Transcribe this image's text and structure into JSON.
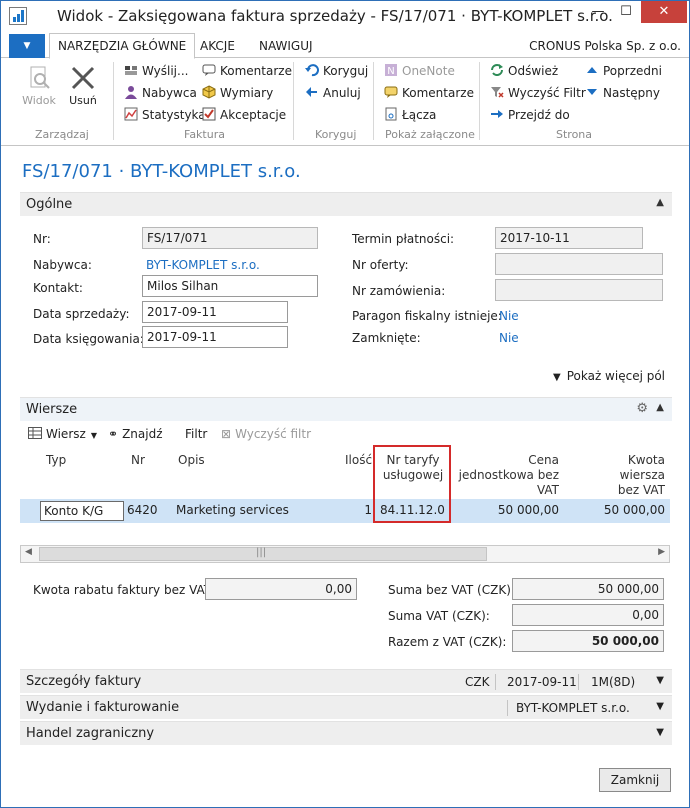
{
  "window": {
    "title": "Widok - Zaksięgowana faktura sprzedaży - FS/17/071 · BYT-KOMPLET s.r.o.",
    "min_glyph": "—",
    "max_glyph": "☐",
    "close_glyph": "✕"
  },
  "tabs": {
    "menu_glyph": "▼",
    "items": [
      "NARZĘDZIA GŁÓWNE",
      "AKCJE",
      "NAWIGUJ"
    ],
    "company": "CRONUS Polska Sp. z o.o."
  },
  "ribbon": {
    "zarzadzaj": {
      "label": "Zarządzaj",
      "widok": "Widok",
      "usun": "Usuń"
    },
    "faktura": {
      "label": "Faktura",
      "wyslij": "Wyślij...",
      "nabywca": "Nabywca",
      "statystyka": "Statystyka",
      "komentarze": "Komentarze",
      "wymiary": "Wymiary",
      "akceptacje": "Akceptacje"
    },
    "koryguj": {
      "label": "Koryguj",
      "koryguj": "Koryguj",
      "anuluj": "Anuluj"
    },
    "zalaczone": {
      "label": "Pokaż załączone",
      "onenote": "OneNote",
      "komentarze": "Komentarze",
      "lacza": "Łącza"
    },
    "strona": {
      "label": "Strona",
      "odswiez": "Odśwież",
      "wyczysc": "Wyczyść Filtr",
      "przejdz": "Przejdź do",
      "poprzedni": "Poprzedni",
      "nastepny": "Następny"
    }
  },
  "page": {
    "title": "FS/17/071 · BYT-KOMPLET s.r.o."
  },
  "ogolne": {
    "header": "Ogólne",
    "nr_label": "Nr:",
    "nr": "FS/17/071",
    "nabywca_label": "Nabywca:",
    "nabywca": "BYT-KOMPLET s.r.o.",
    "kontakt_label": "Kontakt:",
    "kontakt": "Milos Silhan",
    "data_sprzedazy_label": "Data sprzedaży:",
    "data_sprzedazy": "2017-09-11",
    "data_ksiegowania_label": "Data księgowania:",
    "data_ksiegowania": "2017-09-11",
    "termin_label": "Termin płatności:",
    "termin": "2017-10-11",
    "nr_oferty_label": "Nr oferty:",
    "nr_oferty": "",
    "nr_zamowienia_label": "Nr zamówienia:",
    "nr_zamowienia": "",
    "paragon_label": "Paragon fiskalny istnieje:",
    "paragon": "Nie",
    "zamkniete_label": "Zamknięte:",
    "zamkniete": "Nie",
    "more": "Pokaż więcej pól"
  },
  "wiersze": {
    "header": "Wiersze",
    "toolbar": {
      "wiersz": "Wiersz",
      "znajdz": "Znajdź",
      "filtr": "Filtr",
      "wyczysc": "Wyczyść filtr"
    },
    "columns": {
      "typ": "Typ",
      "nr": "Nr",
      "opis": "Opis",
      "ilosc": "Ilość",
      "taryfa1": "Nr taryfy",
      "taryfa2": "usługowej",
      "cena1": "Cena",
      "cena2": "jednostkowa bez",
      "cena3": "VAT",
      "kwota1": "Kwota wiersza",
      "kwota2": "bez VAT"
    },
    "row": {
      "typ": "Konto K/G",
      "nr": "6420",
      "opis": "Marketing services",
      "ilosc": "1",
      "taryfa": "84.11.12.0",
      "cena": "50 000,00",
      "kwota": "50 000,00"
    }
  },
  "totals": {
    "rabat_label": "Kwota rabatu faktury bez VAT:",
    "rabat": "0,00",
    "suma_bez_label": "Suma bez VAT (CZK):",
    "suma_bez": "50 000,00",
    "suma_vat_label": "Suma VAT (CZK):",
    "suma_vat": "0,00",
    "razem_label": "Razem z VAT (CZK):",
    "razem": "50 000,00"
  },
  "szczegoly": {
    "header": "Szczegóły faktury",
    "waluta": "CZK",
    "data": "2017-09-11",
    "termin": "1M(8D)"
  },
  "wydanie": {
    "header": "Wydanie i fakturowanie",
    "nabywca": "BYT-KOMPLET s.r.o."
  },
  "handel": {
    "header": "Handel zagraniczny"
  },
  "footer": {
    "zamknij": "Zamknij"
  },
  "colors": {
    "accent": "#1c6ec2",
    "highlight": "#d42a2a",
    "row_selected": "#cfe3f6"
  }
}
